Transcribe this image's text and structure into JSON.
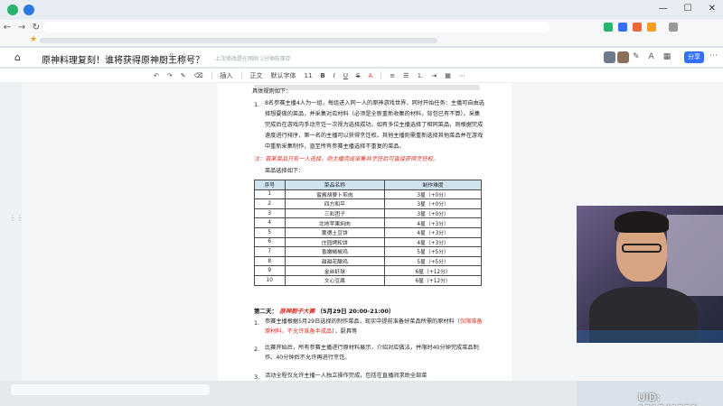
{
  "doc": {
    "title": "原神料理复刻！谁将获得原神厨王称号？",
    "saved_status": "上次修改是在刚刚 1分钟前保存"
  },
  "header": {
    "share_label": "分享"
  },
  "toolbar": {
    "insert": "插入",
    "body_text": "正文",
    "font": "默认字体",
    "size": "11"
  },
  "content": {
    "rules_intro": "具体规则如下：",
    "item1_num": "1.",
    "item1_line1": "8名参赛主播4人为一组，每组进入同一人的原神游戏世界，同时开始任务：主播可自由选",
    "item1_line2": "择想要做的菜品，并采集对应材料（必须是全新重新收集的材料，背包已有不算）。采集",
    "item1_line3": "完成后在游戏内手动烹饪一次视为选择成功。如有多位主播选择了相同菜品，则根据完成",
    "item1_line4": "速度进行排序，第一名的主播可以获得烹饪权。其他主播则需重新选择其他菜品并在游戏",
    "item1_line5": "中重新采集制作，直至所有参赛主播选择不重复的菜品。",
    "note": "注：若某菜品只有一人选择，则主播完成采集并烹饪后可直接获得烹饪权。",
    "dish_choice": "菜品选择如下：",
    "day2_label": "第二天：",
    "day2_event": "原神厨子大赛",
    "day2_time": "（5月29日 20:00-21:00）",
    "d2_item1_num": "1.",
    "d2_item1_line1_a": "参赛主播根据5月29日选择的制作菜品，现实中提前准备好菜品所需的原材料（",
    "d2_item1_line1_red": "仅限准备",
    "d2_item1_line2_red": "原材料，不允许准备半成品",
    "d2_item1_line2_b": "），厨具等",
    "d2_item2_num": "2.",
    "d2_item2_line1": "比赛开始后，所有参赛主播进行原材料展示，介绍对应做法，并限时40分钟完成菜品制",
    "d2_item2_line2": "作。40分钟后不允许再进行烹饪。",
    "d2_item3_num": "3.",
    "d2_item3_line1": "活动全程仅允许主播一人独立操作完成，包括在直播间求助全部菜"
  },
  "table": {
    "headers": [
      "序号",
      "菜品名称",
      "制作难度"
    ],
    "rows": [
      [
        "1",
        "蜜酱胡萝卜煎肉",
        "3星（+0分）"
      ],
      [
        "2",
        "四方和平",
        "3星（+0分）"
      ],
      [
        "3",
        "三彩团子",
        "3星（+0分）"
      ],
      [
        "4",
        "北地苹果焖肉",
        "4星（+3分）"
      ],
      [
        "5",
        "蒙德土豆饼",
        "4星（+3分）"
      ],
      [
        "6",
        "庄园烤松饼",
        "4星（+3分）"
      ],
      [
        "7",
        "香嫩椒椒鸡",
        "5星（+5分）"
      ],
      [
        "8",
        "甜甜花酿鸡",
        "5星（+5分）"
      ],
      [
        "9",
        "金丝虾球",
        "6星（+12分）"
      ],
      [
        "10",
        "文心豆腐",
        "6星（+12分）"
      ]
    ]
  },
  "stream": {
    "uid": "UID: 131341259"
  },
  "icons": [
    "home-icon",
    "share-icon",
    "more-icon",
    "back-icon",
    "forward-icon",
    "refresh-icon",
    "star-icon"
  ]
}
